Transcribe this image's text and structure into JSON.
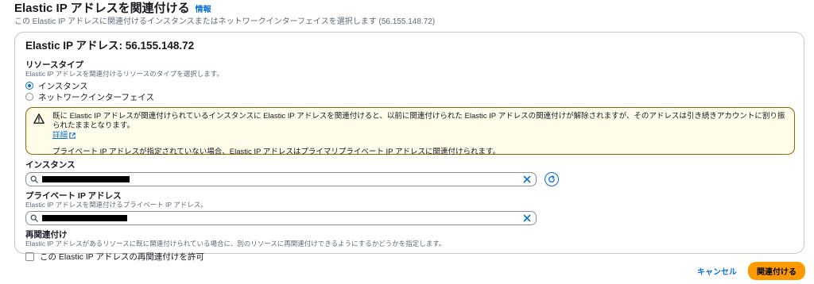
{
  "header": {
    "title": "Elastic IP アドレスを関連付ける",
    "info_link": "情報",
    "description": "この Elastic IP アドレスに関連付けるインスタンスまたはネットワークインターフェイスを選択します (56.155.148.72)"
  },
  "panel": {
    "title": "Elastic IP アドレス: 56.155.148.72",
    "resource_type": {
      "label": "リソースタイプ",
      "description": "Elastic IP アドレスを関連付けるリソースのタイプを選択します。",
      "options": [
        {
          "label": "インスタンス",
          "selected": true
        },
        {
          "label": "ネットワークインターフェイス",
          "selected": false
        }
      ]
    },
    "warning": {
      "icon": "warning-icon",
      "text": "既に Elastic IP アドレスが関連付けられているインスタンスに Elastic IP アドレスを関連付けると、以前に関連付けられた Elastic IP アドレスの関連付けが解除されますが、そのアドレスは引き続きアカウントに割り振られたままとなります。",
      "link": "詳細",
      "note": "プライベート IP アドレスが指定されていない場合、Elastic IP アドレスはプライマリプライベート IP アドレスに関連付けられます。"
    },
    "instance": {
      "label": "インスタンス",
      "value_redacted": true
    },
    "private_ip": {
      "label": "プライベート IP アドレス",
      "description": "Elastic IP アドレスを関連付けるプライベート IP アドレス。",
      "value_redacted": true
    },
    "reassociation": {
      "label": "再関連付け",
      "description": "Elastic IP アドレスがあるリソースに既に関連付けられている場合に、別のリソースに再関連付けできるようにするかどうかを指定します。",
      "checkbox_label": "この Elastic IP アドレスの再関連付けを許可",
      "checked": false
    }
  },
  "footer": {
    "cancel_label": "キャンセル",
    "submit_label": "関連付ける"
  },
  "colors": {
    "link": "#0972d3",
    "primary_button": "#ff9900",
    "warning_border": "#8d6605",
    "warning_background": "#fffce9"
  }
}
